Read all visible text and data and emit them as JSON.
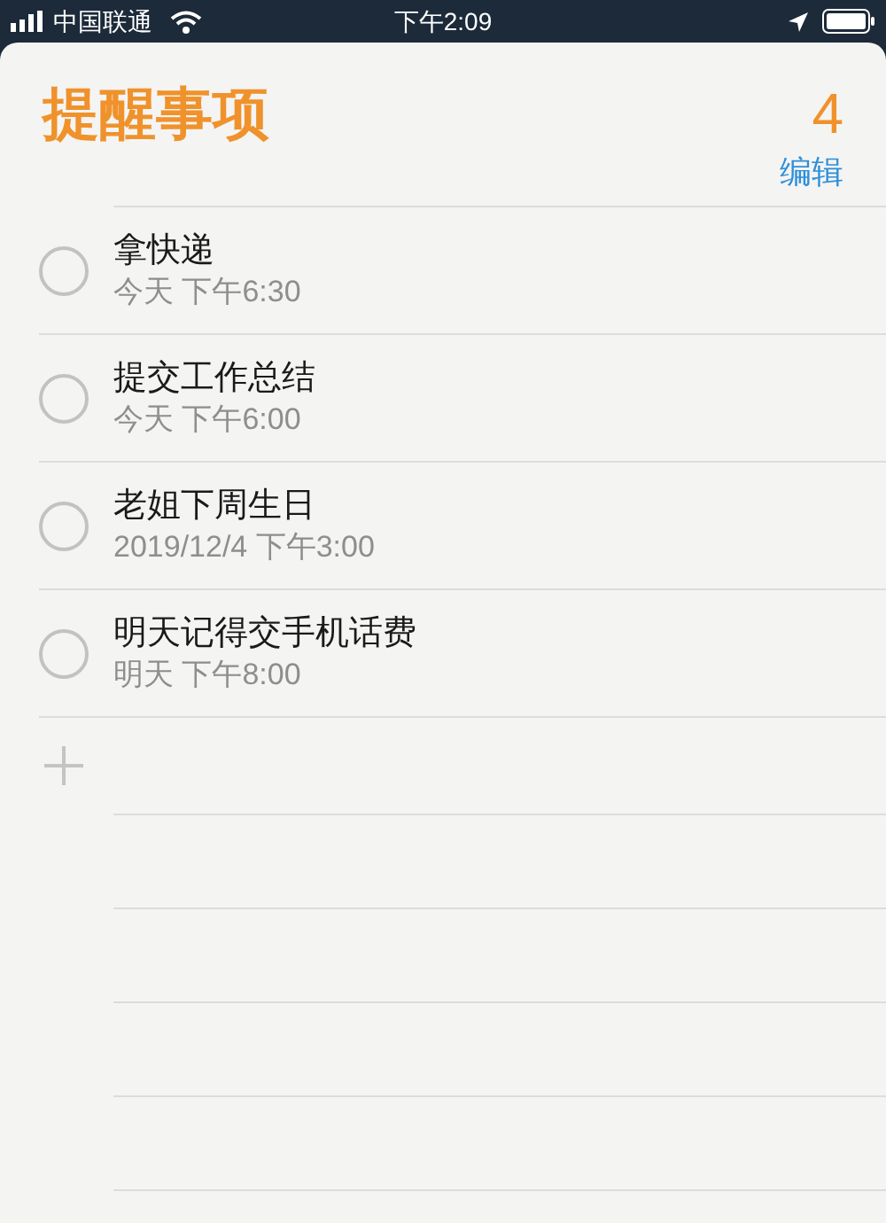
{
  "status_bar": {
    "carrier": "中国联通",
    "time": "下午2:09"
  },
  "header": {
    "title": "提醒事项",
    "count": "4",
    "edit": "编辑"
  },
  "reminders": [
    {
      "title": "拿快递",
      "due": "今天 下午6:30",
      "completed": false
    },
    {
      "title": "提交工作总结",
      "due": "今天 下午6:00",
      "completed": false
    },
    {
      "title": "老姐下周生日",
      "due": "2019/12/4 下午3:00",
      "completed": false
    },
    {
      "title": "明天记得交手机话费",
      "due": "明天 下午8:00",
      "completed": false
    }
  ]
}
